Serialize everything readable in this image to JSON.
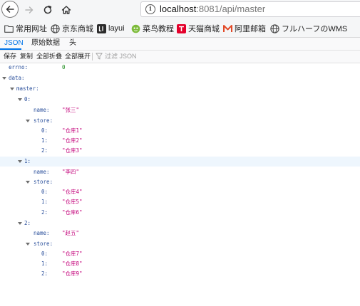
{
  "browser": {
    "url_host": "localhost",
    "url_rest": ":8081/api/master"
  },
  "bookmarks": [
    {
      "label": "常用网址",
      "icon": "folder-icon"
    },
    {
      "label": "京东商城",
      "icon": "globe-icon"
    },
    {
      "label": "layui",
      "icon": "layui-icon"
    },
    {
      "label": "菜鸟教程",
      "icon": "runoob-icon"
    },
    {
      "label": "天猫商城",
      "icon": "tmall-icon"
    },
    {
      "label": "阿里邮箱",
      "icon": "aliyun-mail-icon"
    },
    {
      "label": "フルハーフのWMS",
      "icon": "globe-icon"
    }
  ],
  "viewer": {
    "tabs": [
      "JSON",
      "原始数据",
      "头"
    ],
    "active_tab": "JSON",
    "actions": [
      "保存",
      "复制",
      "全部折叠",
      "全部展开"
    ],
    "filter_placeholder": "过滤 JSON"
  },
  "json": {
    "errno_key": "errno:",
    "errno_value": "0",
    "data_key": "data:",
    "master_key": "master:",
    "items": [
      {
        "index": "0:",
        "name_key": "name:",
        "name": "\"张三\"",
        "store_key": "store:",
        "stores": [
          {
            "i": "0:",
            "v": "\"仓库1\""
          },
          {
            "i": "1:",
            "v": "\"仓库2\""
          },
          {
            "i": "2:",
            "v": "\"仓库3\""
          }
        ]
      },
      {
        "index": "1:",
        "name_key": "name:",
        "name": "\"李四\"",
        "store_key": "store:",
        "stores": [
          {
            "i": "0:",
            "v": "\"仓库4\""
          },
          {
            "i": "1:",
            "v": "\"仓库5\""
          },
          {
            "i": "2:",
            "v": "\"仓库6\""
          }
        ]
      },
      {
        "index": "2:",
        "name_key": "name:",
        "name": "\"赵五\"",
        "store_key": "store:",
        "stores": [
          {
            "i": "0:",
            "v": "\"仓库7\""
          },
          {
            "i": "1:",
            "v": "\"仓库8\""
          },
          {
            "i": "2:",
            "v": "\"仓库9\""
          }
        ]
      }
    ]
  },
  "colors": {
    "accent": "#0074e8",
    "key": "#2a4f9b",
    "string": "#c3007a",
    "number": "#1a8a1a",
    "highlight_row": "#eef6fd"
  }
}
